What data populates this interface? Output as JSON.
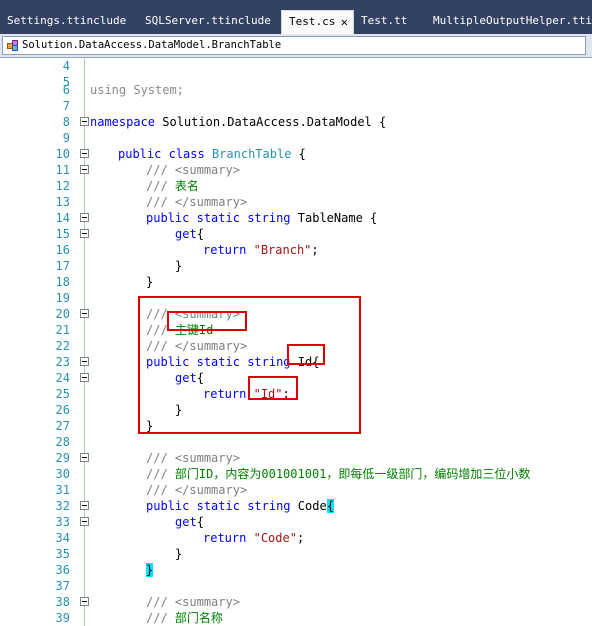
{
  "tabs": [
    {
      "label": "Settings.ttinclude",
      "active": false
    },
    {
      "label": "SQLServer.ttinclude",
      "active": false
    },
    {
      "label": "Test.cs",
      "active": true
    },
    {
      "label": "Test.tt",
      "active": false
    },
    {
      "label": "MultipleOutputHelper.ttinclude",
      "active": false
    }
  ],
  "tab_close_glyph": "✕",
  "navigation": {
    "label": "Solution.DataAccess.DataModel.BranchTable",
    "icon": "class-icon"
  },
  "code": {
    "using_kw": "using",
    "using_rest": " System;",
    "ns_kw": "namespace",
    "ns_name": " Solution.DataAccess.DataModel {",
    "public_kw": "public",
    "class_kw": "class",
    "static_kw": "static",
    "string_kw": "string",
    "get_kw": "get",
    "return_kw": "return",
    "class_name": "BranchTable",
    "open_brace": "{",
    "close_brace": "}",
    "semicolon": ";",
    "doc_prefix": "///",
    "summary_open": "<summary>",
    "summary_close": "</summary>",
    "comment_tablename": "表名",
    "prop_tablename": "TableName",
    "str_branch": "\"Branch\"",
    "comment_id": "主键Id",
    "prop_id": "Id",
    "str_id": "\"Id\"",
    "comment_code": "部门ID，内容为001001001，即每低一级部门，编码增加三位小数",
    "prop_code": "Code",
    "str_code": "\"Code\"",
    "comment_name": "部门名称"
  },
  "line_numbers": [
    "4",
    "5",
    "6",
    "7",
    "8",
    "9",
    "10",
    "11",
    "12",
    "13",
    "14",
    "15",
    "16",
    "17",
    "18",
    "19",
    "20",
    "21",
    "22",
    "23",
    "24",
    "25",
    "26",
    "27",
    "28",
    "29",
    "30",
    "31",
    "32",
    "33",
    "34",
    "35",
    "36",
    "37",
    "38",
    "39"
  ],
  "colors": {
    "keyword": "#0000ff",
    "type": "#2b91af",
    "comment": "#008000",
    "string": "#a31515",
    "annotation": "#e00000",
    "tab_bar": "#334162"
  }
}
